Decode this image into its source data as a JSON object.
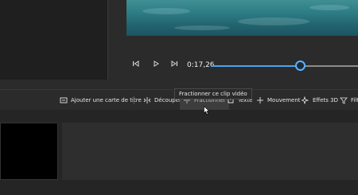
{
  "player": {
    "time": "0:17,26",
    "progress": 0.61
  },
  "toolbar": {
    "add_title_card": "Ajouter une carte de titre",
    "trim": "Découper",
    "split": "Fractionner",
    "text": "Texte",
    "motion": "Mouvement",
    "effects_3d": "Effets 3D",
    "filters": "Filtres"
  },
  "tooltip": {
    "split": "Fractionner ce clip vidéo"
  },
  "icons": {
    "previous": "skip-back-icon",
    "play": "play-icon",
    "next": "skip-forward-icon",
    "title_card": "title-card-icon",
    "trim": "trim-icon",
    "split": "split-icon",
    "text": "text-icon",
    "motion": "motion-icon",
    "effects_3d": "sparkle-icon",
    "filters": "filter-icon"
  },
  "colors": {
    "accent": "#4aa3f0"
  }
}
